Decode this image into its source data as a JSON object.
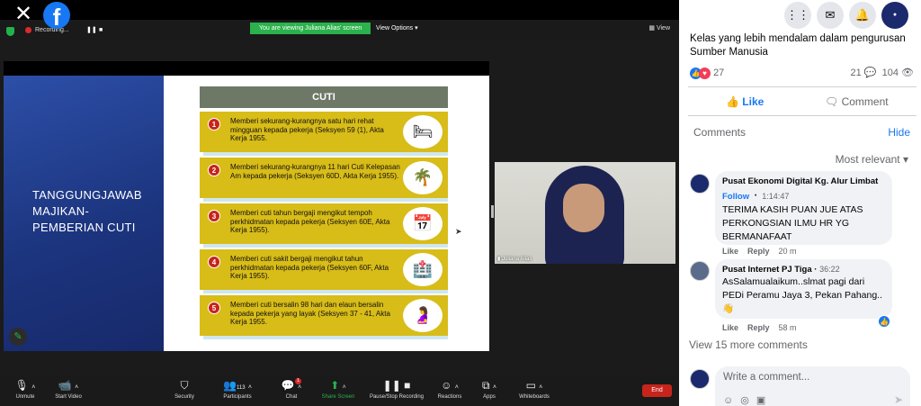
{
  "zoom": {
    "recording_label": "Recording...",
    "viewing_banner": "You are viewing Juliana Alias' screen",
    "view_options": "View Options",
    "view_button": "View",
    "participant_name": "Juliana Alias",
    "toolbar": {
      "unmute": "Unmute",
      "start_video": "Start Video",
      "security": "Security",
      "participants": "Participants",
      "participants_count": "113",
      "chat": "Chat",
      "chat_badge": "1",
      "share_screen": "Share Screen",
      "pause_recording": "Pause/Stop Recording",
      "reactions": "Reactions",
      "apps": "Apps",
      "whiteboards": "Whiteboards",
      "end": "End"
    }
  },
  "slide": {
    "title": "TANGGUNGJAWAB MAJIKAN-PEMBERIAN CUTI",
    "heading": "CUTI",
    "items": [
      {
        "num": "1",
        "text": "Memberi sekurang-kurangnya satu hari rehat mingguan kepada pekerja (Seksyen 59 (1), Akta Kerja 1955.",
        "icon": "bed-icon"
      },
      {
        "num": "2",
        "text": "Memberi sekurang-kurangnya 11 hari Cuti Kelepasan Am kepada pekerja (Seksyen 60D, Akta Kerja 1955).",
        "icon": "beach-icon"
      },
      {
        "num": "3",
        "text": "Memberi cuti tahun bergaji mengikut tempoh perkhidmatan kepada pekerja (Seksyen 60E, Akta Kerja 1955).",
        "icon": "calendar-icon"
      },
      {
        "num": "4",
        "text": "Memberi cuti sakit bergaji mengikut tahun perkhidmatan kepada pekerja (Seksyen 60F, Akta Kerja 1955).",
        "icon": "hospital-bed-icon"
      },
      {
        "num": "5",
        "text": "Memberi cuti bersalin 98 hari dan elaun bersalin kepada pekerja yang layak (Seksyen 37 - 41, Akta Kerja 1955.",
        "icon": "pregnant-icon"
      }
    ]
  },
  "facebook": {
    "post_text": "Kelas yang lebih mendalam dalam pengurusan Sumber Manusia",
    "reactions_count": "27",
    "comments_count": "21",
    "views_count": "104",
    "like_label": "Like",
    "comment_label": "Comment",
    "comments_heading": "Comments",
    "hide_label": "Hide",
    "sort_label": "Most relevant",
    "comments": [
      {
        "name": "Pusat Ekonomi Digital Kg. Alur Limbat",
        "follow": "Follow",
        "stamp": "1:14:47",
        "body": "TERIMA KASIH PUAN JUE ATAS PERKONGSIAN ILMU HR YG BERMANAFAAT",
        "like": "Like",
        "reply": "Reply",
        "age": "20 m"
      },
      {
        "name": "Pusat Internet PJ Tiga",
        "stamp": "36:22",
        "body": "AsSalamualaikum..slmat pagi dari PEDi Peramu Jaya 3, Pekan Pahang..",
        "emoji": "👋",
        "like": "Like",
        "reply": "Reply",
        "age": "58 m"
      }
    ],
    "view_more": "View 15 more comments",
    "write_placeholder": "Write a comment..."
  }
}
